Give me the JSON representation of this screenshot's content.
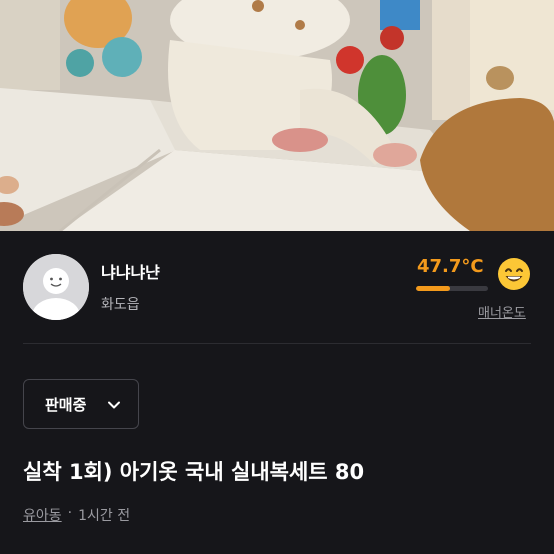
{
  "listing_photo": {
    "description_icon": "product-photo"
  },
  "seller": {
    "name": "냐냐냐냔",
    "location": "화도읍",
    "avatar_icon": "default-avatar-icon"
  },
  "manner": {
    "temperature": "47.7°C",
    "temperature_value": 47.7,
    "bar_fill_fraction": 0.477,
    "label": "매너온도",
    "face_icon": "smiling-face-icon",
    "accent_color": "#f39a1c"
  },
  "status": {
    "label": "판매중",
    "chevron_icon": "chevron-down-icon"
  },
  "listing": {
    "title": "실착 1회) 아기옷 국내 실내복세트 80",
    "category": "유아동",
    "separator": "·",
    "time": "1시간 전"
  }
}
